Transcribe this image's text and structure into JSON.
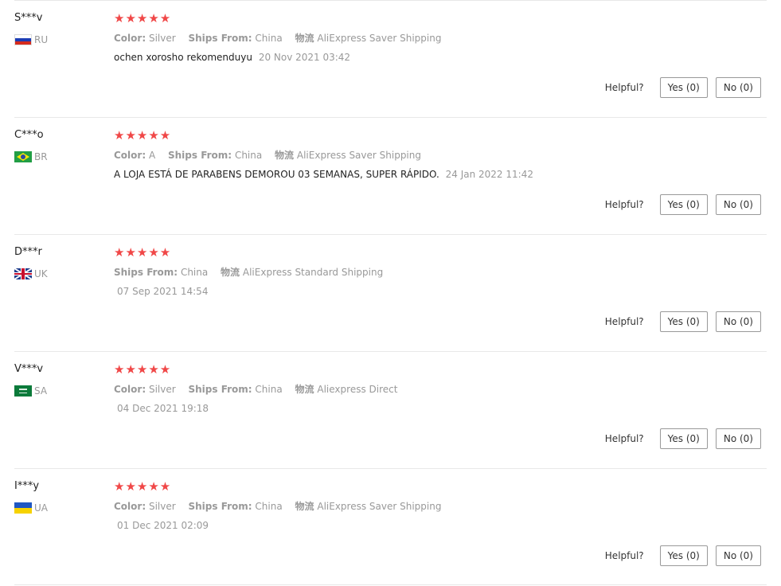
{
  "reviews": [
    {
      "user": "S***v",
      "country_code": "RU",
      "flag_icon": "russia-flag-icon",
      "stars": "★★★★★",
      "rating": 5,
      "attributes": [
        {
          "key": "Color:",
          "value": "Silver"
        },
        {
          "key": "Ships From:",
          "value": "China"
        },
        {
          "key": "物流",
          "value": "AliExpress Saver Shipping"
        }
      ],
      "feedback": "ochen xorosho rekomenduyu",
      "date": "20 Nov 2021 03:42",
      "helpful_label": "Helpful?",
      "yes_label": "Yes (0)",
      "no_label": "No (0)"
    },
    {
      "user": "C***o",
      "country_code": "BR",
      "flag_icon": "brazil-flag-icon",
      "stars": "★★★★★",
      "rating": 5,
      "attributes": [
        {
          "key": "Color:",
          "value": "A"
        },
        {
          "key": "Ships From:",
          "value": "China"
        },
        {
          "key": "物流",
          "value": "AliExpress Saver Shipping"
        }
      ],
      "feedback": "A LOJA ESTÁ DE PARABENS DEMOROU 03 SEMANAS, SUPER RÁPIDO.",
      "date": "24 Jan 2022 11:42",
      "helpful_label": "Helpful?",
      "yes_label": "Yes (0)",
      "no_label": "No (0)"
    },
    {
      "user": "D***r",
      "country_code": "UK",
      "flag_icon": "uk-flag-icon",
      "stars": "★★★★★",
      "rating": 5,
      "attributes": [
        {
          "key": "Ships From:",
          "value": "China"
        },
        {
          "key": "物流",
          "value": "AliExpress Standard Shipping"
        }
      ],
      "feedback": "",
      "date": "07 Sep 2021 14:54",
      "helpful_label": "Helpful?",
      "yes_label": "Yes (0)",
      "no_label": "No (0)"
    },
    {
      "user": "V***v",
      "country_code": "SA",
      "flag_icon": "saudi-arabia-flag-icon",
      "stars": "★★★★★",
      "rating": 5,
      "attributes": [
        {
          "key": "Color:",
          "value": "Silver"
        },
        {
          "key": "Ships From:",
          "value": "China"
        },
        {
          "key": "物流",
          "value": "Aliexpress Direct"
        }
      ],
      "feedback": "",
      "date": "04 Dec 2021 19:18",
      "helpful_label": "Helpful?",
      "yes_label": "Yes (0)",
      "no_label": "No (0)"
    },
    {
      "user": "I***y",
      "country_code": "UA",
      "flag_icon": "ukraine-flag-icon",
      "stars": "★★★★★",
      "rating": 5,
      "attributes": [
        {
          "key": "Color:",
          "value": "Silver"
        },
        {
          "key": "Ships From:",
          "value": "China"
        },
        {
          "key": "物流",
          "value": "AliExpress Saver Shipping"
        }
      ],
      "feedback": "",
      "date": "01 Dec 2021 02:09",
      "helpful_label": "Helpful?",
      "yes_label": "Yes (0)",
      "no_label": "No (0)"
    }
  ],
  "colors": {
    "star": "#f04747",
    "muted_text": "#999999",
    "divider": "#e8e8e8"
  }
}
